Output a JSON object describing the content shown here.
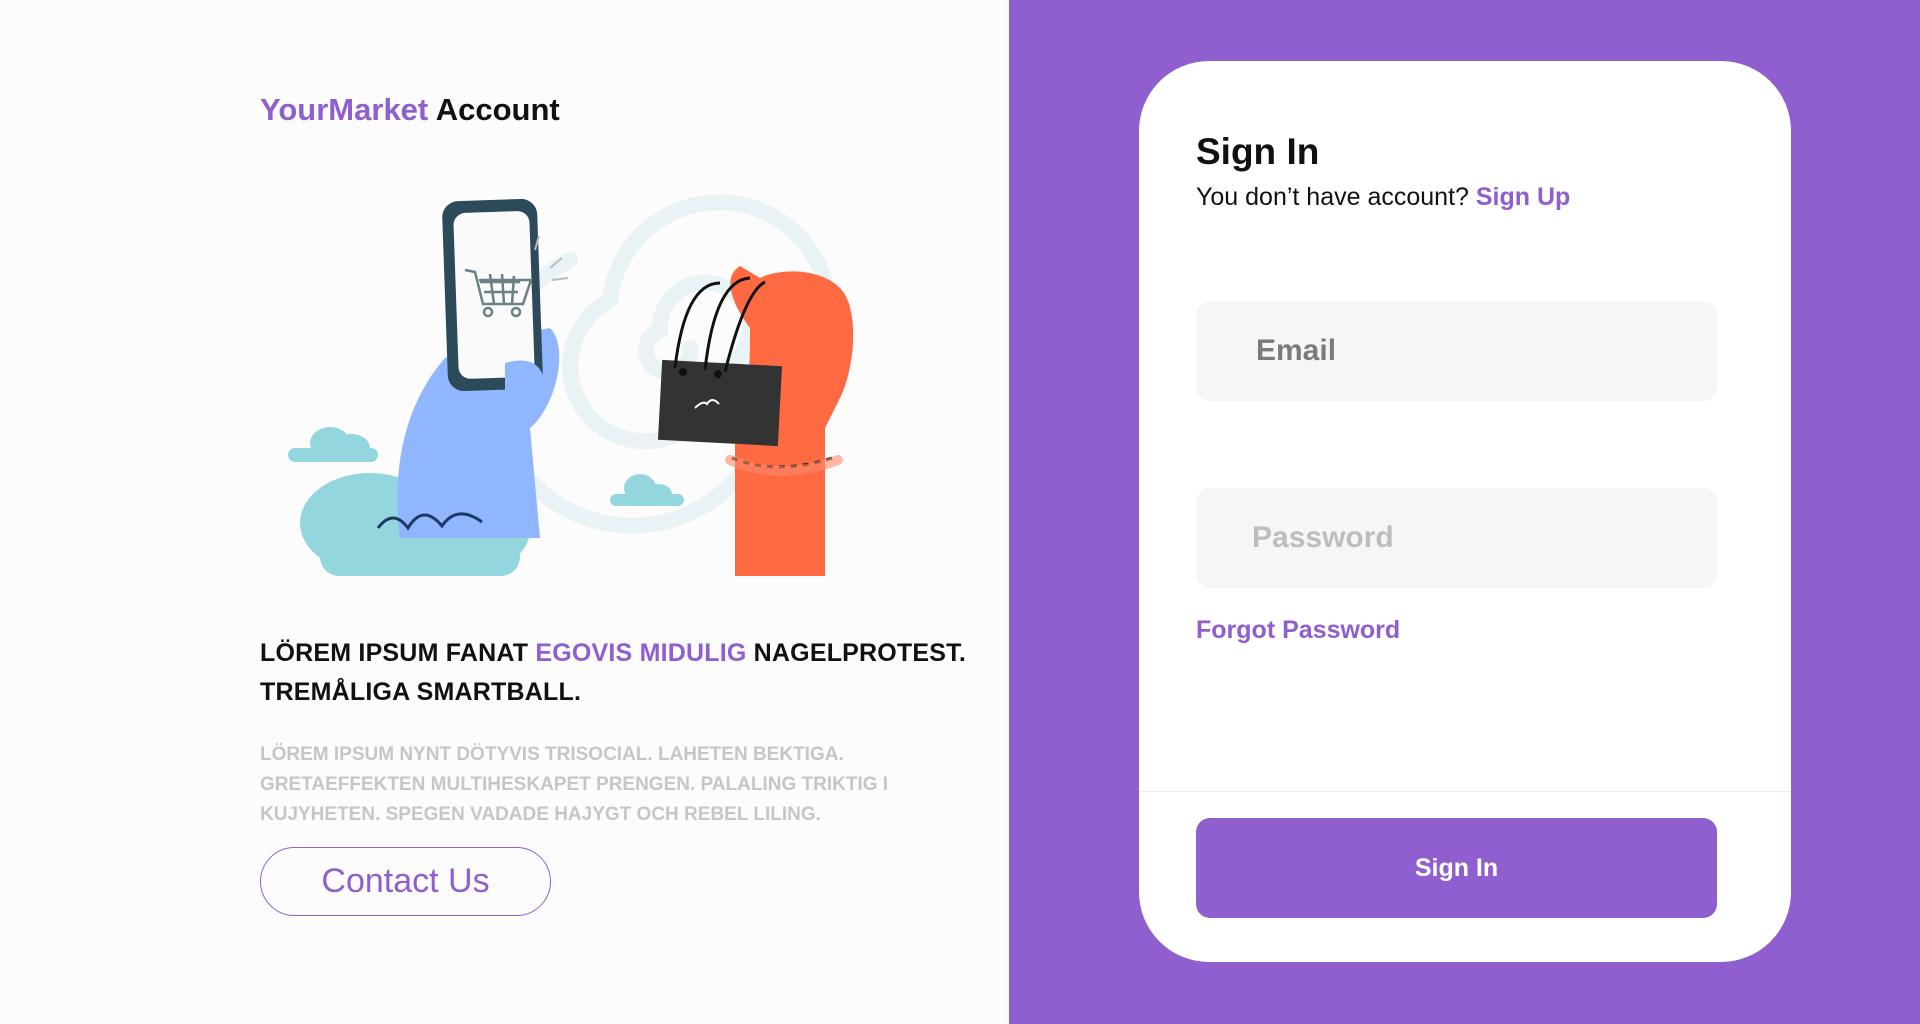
{
  "brand": {
    "accent": "YourMarket",
    "rest": "Account"
  },
  "hero": {
    "headline_part1": "LÖREM IPSUM FANAT ",
    "headline_accent": "EGOVIS MIDULIG",
    "headline_part2": " NAGELPROTEST. TREMÅLIGA SMARTBALL.",
    "body": "LÖREM IPSUM NYNT DÖTYVIS TRISOCIAL. LAHETEN BEKTIGA. GRETAEFFEKTEN MULTIHESKAPET PRENGEN. PALALING TRIKTIG I KUJYHETEN. SPEGEN VADADE HAJYGT OCH REBEL LILING.",
    "contact_label": "Contact Us",
    "illustration_icon": "shopping-phone-bag-illustration"
  },
  "signin": {
    "title": "Sign In",
    "prompt": "You don’t have account?",
    "signup_link": "Sign Up",
    "email_placeholder": "Email",
    "password_placeholder": "Password",
    "forgot_label": "Forgot Password",
    "submit_label": "Sign In"
  },
  "colors": {
    "accent": "#8f5ecf",
    "left_background": "#fcfcfc",
    "card_background": "#ffffff",
    "field_background": "#f6f6f6"
  }
}
